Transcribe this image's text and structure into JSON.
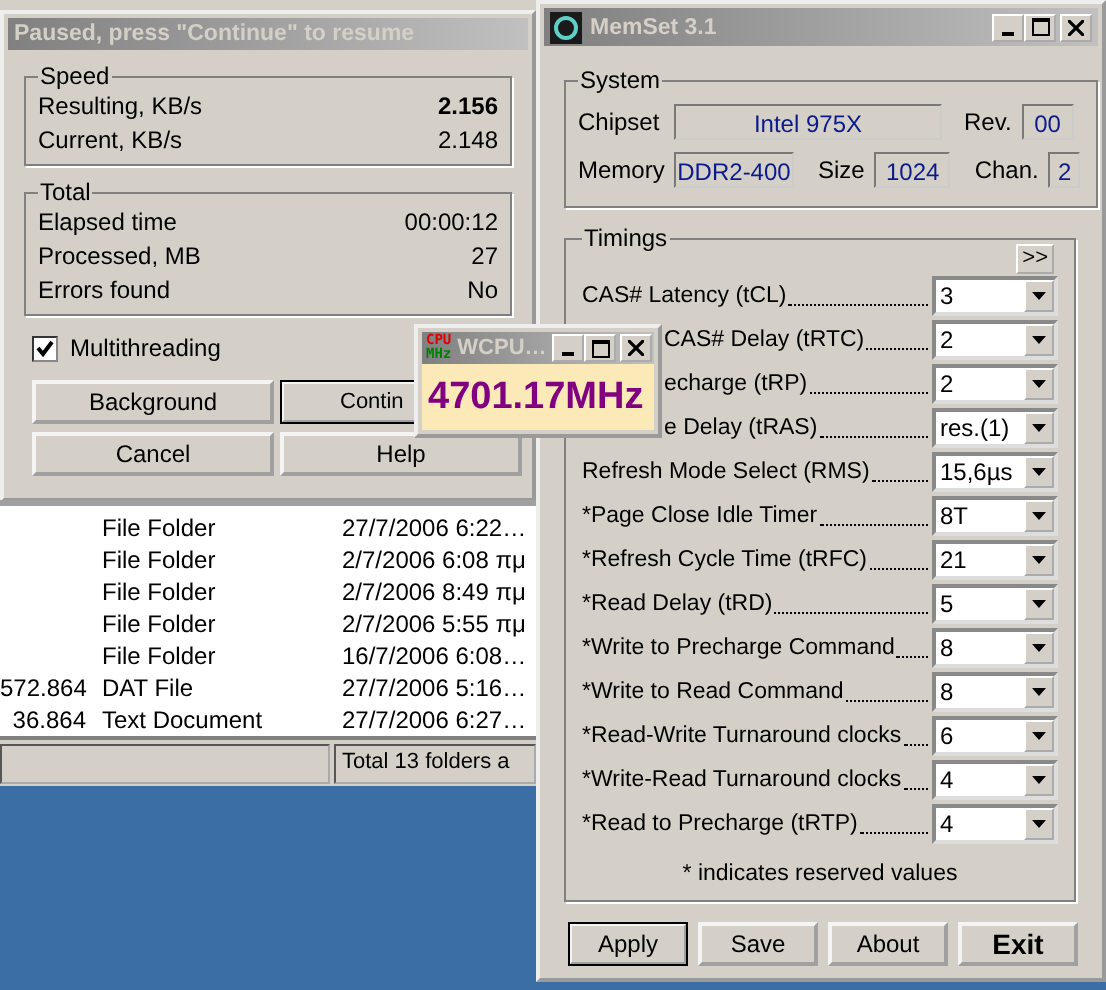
{
  "test_window": {
    "title": "Paused, press \"Continue\" to resume",
    "speed": {
      "label": "Speed",
      "rows": [
        {
          "label": "Resulting, KB/s",
          "value": "2.156",
          "bold": true
        },
        {
          "label": "Current, KB/s",
          "value": "2.148",
          "bold": false
        }
      ]
    },
    "total": {
      "label": "Total",
      "rows": [
        {
          "label": "Elapsed time",
          "value": "00:00:12",
          "bold": false
        },
        {
          "label": "Processed, MB",
          "value": "27",
          "bold": false
        },
        {
          "label": "Errors found",
          "value": "No",
          "bold": false
        }
      ]
    },
    "multithreading": {
      "label": "Multithreading",
      "checked": true
    },
    "buttons": [
      {
        "label": "Background",
        "focused": false
      },
      {
        "label": "Contin",
        "focused": true
      },
      {
        "label": "Cancel",
        "focused": false
      },
      {
        "label": "Help",
        "focused": false
      }
    ]
  },
  "explorer": {
    "rows": [
      {
        "type": "File Folder",
        "date": "27/7/2006 6:22…"
      },
      {
        "type": "File Folder",
        "date": "2/7/2006 6:08 πμ"
      },
      {
        "type": "File Folder",
        "date": "2/7/2006 8:49 πμ"
      },
      {
        "type": "File Folder",
        "date": "2/7/2006 5:55 πμ"
      },
      {
        "type": "File Folder",
        "date": "16/7/2006 6:08…"
      },
      {
        "size": "572.864",
        "type": "DAT File",
        "date": "27/7/2006 5:16…"
      },
      {
        "size": "36.864",
        "type": "Text Document",
        "date": "27/7/2006 6:27…"
      }
    ],
    "status_bar": {
      "text": "Total 13 folders a"
    }
  },
  "wcpu": {
    "title": "WCPU…",
    "icon_text": [
      "CPU",
      "MHz"
    ],
    "reading": "4701.17MHz"
  },
  "memset": {
    "title": "MemSet 3.1",
    "system": {
      "label": "System",
      "lines": [
        {
          "fields": [
            {
              "label": "Chipset",
              "value": "Intel 975X"
            },
            {
              "label": "Rev.",
              "value": "00"
            }
          ]
        },
        {
          "fields": [
            {
              "label": "Memory",
              "value": "DDR2-400"
            },
            {
              "label": "Size",
              "value": "1024"
            },
            {
              "label": "Chan.",
              "value": "2"
            }
          ]
        }
      ]
    },
    "timings": {
      "label": "Timings",
      "more": ">>",
      "rows": [
        {
          "kind": "full",
          "label": "CAS# Latency (tCL)",
          "value": "3"
        },
        {
          "kind": "covered",
          "label": "CAS# Delay (tRTC)",
          "value": "2"
        },
        {
          "kind": "covered",
          "label": "echarge (tRP)",
          "value": "2"
        },
        {
          "kind": "covered",
          "label": "e Delay  (tRAS)",
          "value": "res.(1)"
        },
        {
          "kind": "full",
          "label": "Refresh Mode Select (RMS)",
          "value": "15,6µs"
        },
        {
          "kind": "full",
          "label": "*Page Close Idle Timer",
          "value": "8T"
        },
        {
          "kind": "full",
          "label": "*Refresh Cycle Time (tRFC)",
          "value": "21"
        },
        {
          "kind": "full",
          "label": "*Read Delay (tRD)",
          "value": "5"
        },
        {
          "kind": "full",
          "label": "*Write to Precharge Command",
          "value": "8"
        },
        {
          "kind": "full",
          "label": "*Write to Read Command",
          "value": "8"
        },
        {
          "kind": "full",
          "label": "*Read-Write Turnaround clocks",
          "value": "6"
        },
        {
          "kind": "full",
          "label": "*Write-Read Turnaround clocks",
          "value": "4"
        },
        {
          "kind": "full",
          "label": "*Read to Precharge (tRTP)",
          "value": "4"
        }
      ],
      "note": "* indicates reserved values"
    },
    "buttons": [
      {
        "label": "Apply",
        "default": true,
        "bold": false
      },
      {
        "label": "Save",
        "default": false,
        "bold": false
      },
      {
        "label": "About",
        "default": false,
        "bold": false
      },
      {
        "label": "Exit",
        "default": false,
        "bold": true
      }
    ]
  }
}
